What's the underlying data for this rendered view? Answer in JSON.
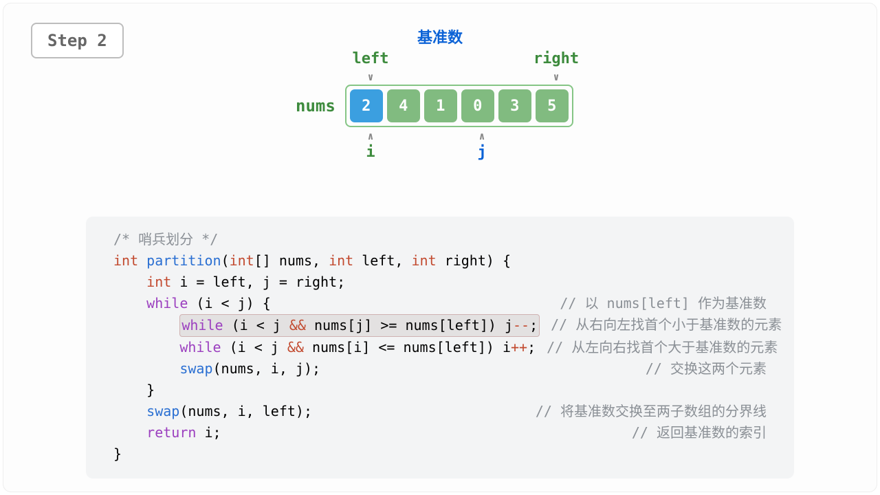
{
  "step": {
    "label": "Step 2"
  },
  "viz": {
    "pivot_label": "基准数",
    "nums_label": "nums",
    "left_label": "left",
    "right_label": "right",
    "i_label": "i",
    "j_label": "j",
    "cells": [
      "2",
      "4",
      "1",
      "0",
      "3",
      "5"
    ],
    "pivot_index": 0,
    "left_index": 0,
    "right_index": 5,
    "i_index": 0,
    "j_index": 3
  },
  "code": {
    "comment_header": "/* 哨兵划分 */",
    "sig_type": "int",
    "sig_fn": "partition",
    "sig_params": "(int[] nums, int left, int right) {",
    "line_decl_a": "int",
    "line_decl_b": " i = left, j = right;",
    "while_outer": "while (i < j) {",
    "inner1": "while (i < j && nums[j] >= nums[left]) j--;",
    "inner2": "while (i < j && nums[i] <= nums[left]) i++;",
    "swap_inner": "swap(nums, i, j);",
    "brace_close_inner": "}",
    "swap_outer": "swap(nums, i, left);",
    "return_kw": "return",
    "return_rest": " i;",
    "brace_close": "}",
    "c0": "// 以 nums[left] 作为基准数",
    "c1": "// 从右向左找首个小于基准数的元素",
    "c2": "// 从左向右找首个大于基准数的元素",
    "c3": "// 交换这两个元素",
    "c4": "// 将基准数交换至两子数组的分界线",
    "c5": "// 返回基准数的索引"
  }
}
